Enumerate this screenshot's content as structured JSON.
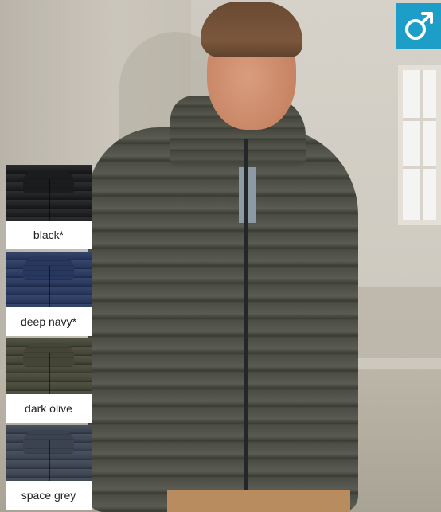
{
  "gender_badge": {
    "icon": "male-symbol-icon",
    "color": "#1d9ec9"
  },
  "swatches": [
    {
      "label": "black*",
      "color": "#1b1c1e"
    },
    {
      "label": "deep navy*",
      "color": "#27375e"
    },
    {
      "label": "dark olive",
      "color": "#444536"
    },
    {
      "label": "space grey",
      "color": "#3b4351"
    }
  ]
}
